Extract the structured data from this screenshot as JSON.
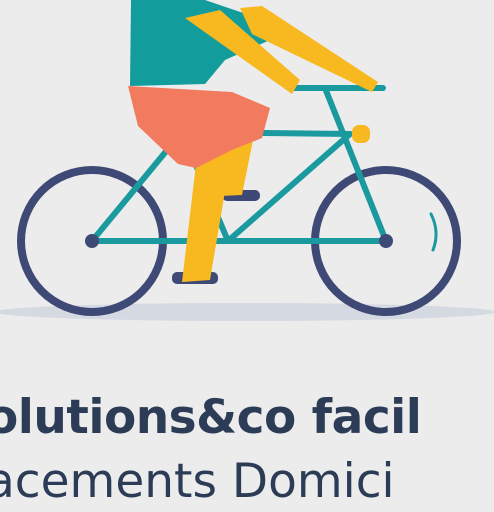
{
  "illustration": {
    "icon": "person-riding-bicycle-illustration",
    "colors": {
      "background": "#ececed",
      "wheel": "#3e4a75",
      "frame": "#1a9a9f",
      "shirt": "#139c9c",
      "shorts": "#f27a5e",
      "skin": "#f7b820",
      "shadow": "#d5d9e2"
    }
  },
  "text": {
    "headline": "olutions&co facil",
    "subline": "acements Domici",
    "color": "#2d3c56"
  }
}
